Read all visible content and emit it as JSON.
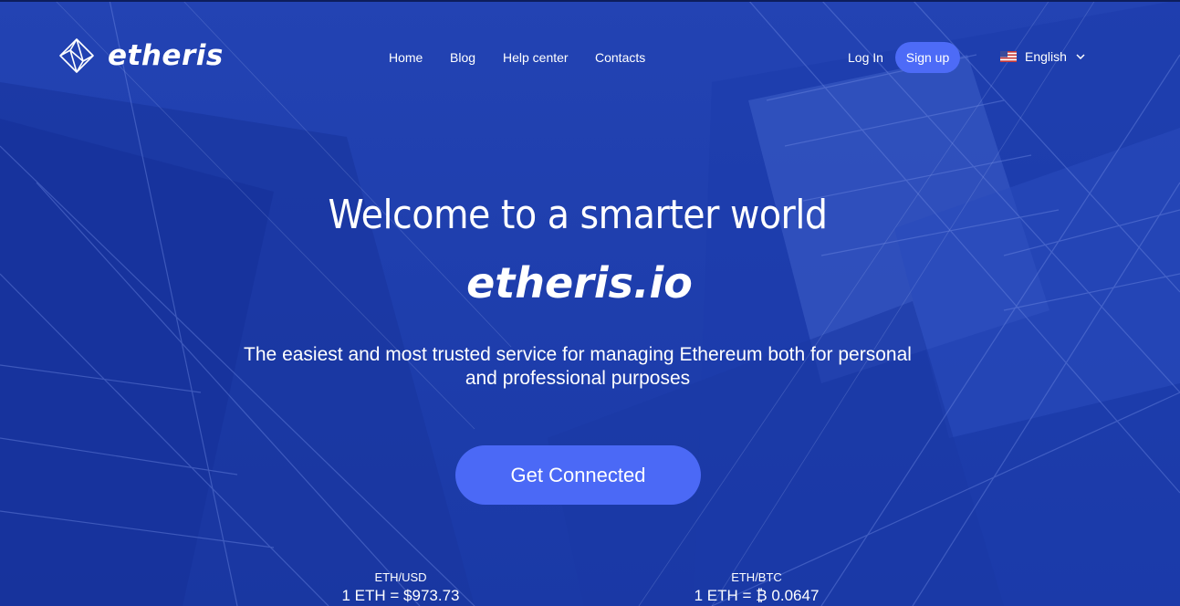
{
  "brand": {
    "logo_text": "etheris",
    "hero_brand": "etheris.io"
  },
  "nav": {
    "items": [
      "Home",
      "Blog",
      "Help center",
      "Contacts"
    ]
  },
  "auth": {
    "login_label": "Log In",
    "signup_label": "Sign up"
  },
  "language": {
    "selected": "English",
    "flag_icon": "us-flag-icon"
  },
  "hero": {
    "headline": "Welcome to a smarter world",
    "tagline": "The easiest and most trusted service for managing Ethereum both for personal and professional purposes",
    "cta_label": "Get Connected"
  },
  "rates": [
    {
      "pair": "ETH/USD",
      "value": "1 ETH = $973.73"
    },
    {
      "pair": "ETH/BTC",
      "value": "1 ETH = ₿ 0.0647"
    }
  ],
  "colors": {
    "background": "#1f3fae",
    "accent": "#4b69f6",
    "text": "#ffffff"
  }
}
